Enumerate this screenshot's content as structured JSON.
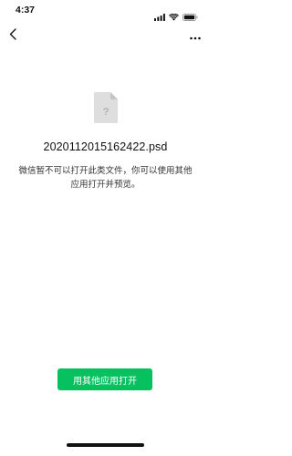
{
  "status_bar": {
    "time": "4:37",
    "icons": [
      "signal-icon",
      "wifi-icon",
      "battery-icon"
    ]
  },
  "nav": {
    "back_icon": "chevron-left-icon",
    "more_icon": "more-horizontal-icon"
  },
  "file": {
    "icon": "unknown-file-icon",
    "name": "20201120151624​22.psd",
    "message": "微信暂不可以打开此类文件，你可以使用其他应用打开并预览。"
  },
  "actions": {
    "open_with_other_app_label": "用其他应用打开"
  },
  "colors": {
    "accent": "#07c160",
    "file_icon": "#d9d9d9"
  }
}
